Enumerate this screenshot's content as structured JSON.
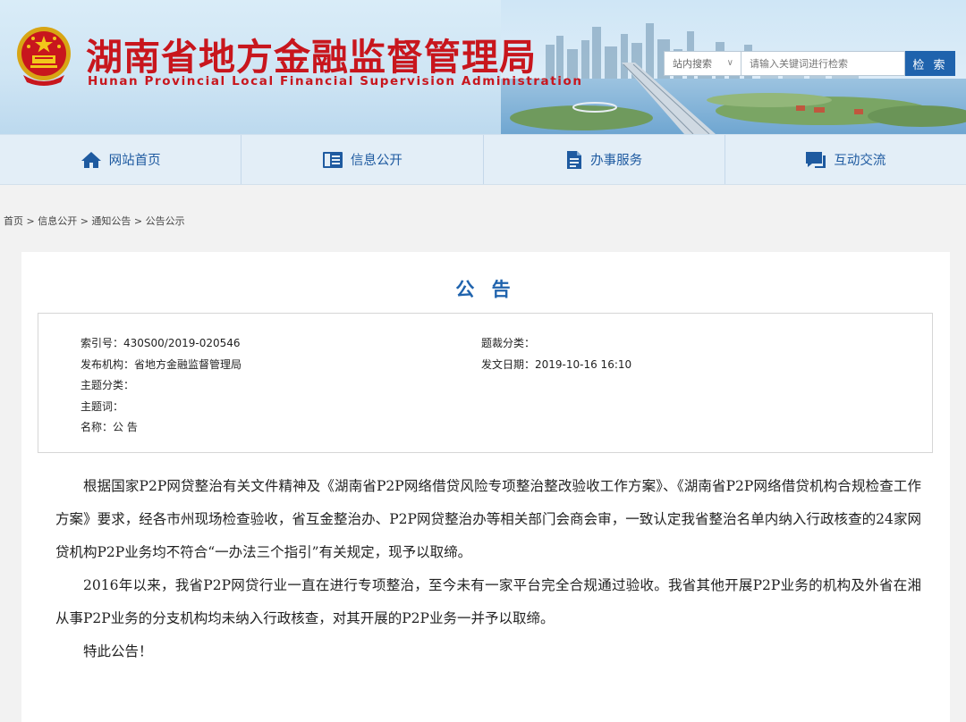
{
  "header": {
    "title": "湖南省地方金融监督管理局",
    "subtitle": "Hunan Provincial Local Financial Supervision Administration"
  },
  "search": {
    "scope": "站内搜索",
    "placeholder": "请输入关键词进行检索",
    "button": "检 索"
  },
  "nav": {
    "items": [
      {
        "label": "网站首页",
        "icon": "home-icon"
      },
      {
        "label": "信息公开",
        "icon": "list-icon"
      },
      {
        "label": "办事服务",
        "icon": "document-icon"
      },
      {
        "label": "互动交流",
        "icon": "chat-icon"
      }
    ]
  },
  "breadcrumb": "首页 > 信息公开 > 通知公告 > 公告公示",
  "notice": {
    "title": "公 告",
    "meta": {
      "index_no": "索引号：430S00/2019-020546",
      "publisher": "发布机构：省地方金融监督管理局",
      "subject_category": "主题分类：",
      "keywords": "主题词：",
      "name": "名称：公 告",
      "genre_category": "题裁分类：",
      "publish_date": "发文日期：2019-10-16 16:10"
    },
    "paragraphs": [
      "根据国家P2P网贷整治有关文件精神及《湖南省P2P网络借贷风险专项整治整改验收工作方案》、《湖南省P2P网络借贷机构合规检查工作方案》要求，经各市州现场检查验收，省互金整治办、P2P网贷整治办等相关部门会商会审，一致认定我省整治名单内纳入行政核查的24家网贷机构P2P业务均不符合“一办法三个指引”有关规定，现予以取缔。",
      "2016年以来，我省P2P网贷行业一直在进行专项整治，至今未有一家平台完全合规通过验收。我省其他开展P2P业务的机构及外省在湘从事P2P业务的分支机构均未纳入行政核查，对其开展的P2P业务一并予以取缔。",
      "特此公告！"
    ]
  },
  "colors": {
    "title_red": "#c8161d",
    "brand_blue": "#1f63ad",
    "nav_bg": "#e3eef7"
  }
}
